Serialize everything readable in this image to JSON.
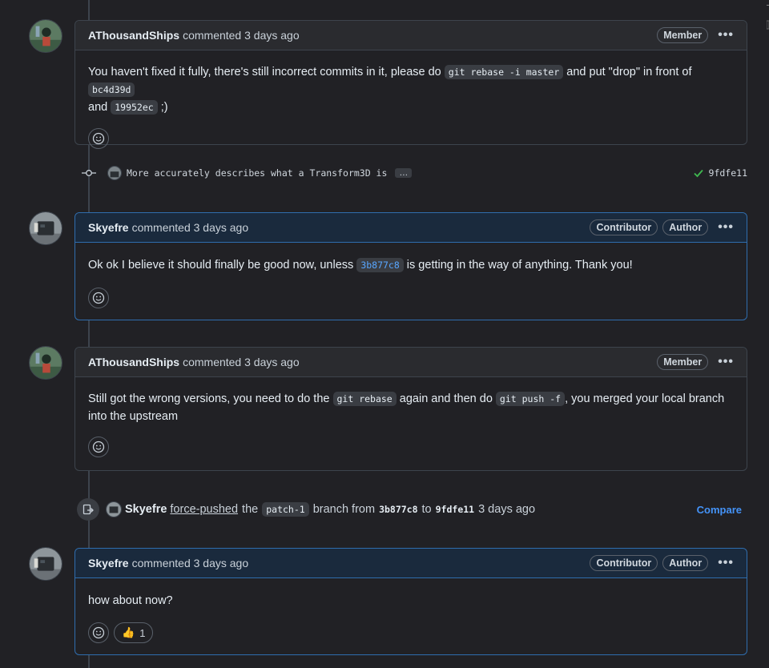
{
  "comments": [
    {
      "author": "AThousandShips",
      "action": "commented 3 days ago",
      "badges": [
        "Member"
      ],
      "body": {
        "t1": "You haven't fixed it fully, there's still incorrect commits in it, please do ",
        "c1": "git rebase -i master",
        "t2": " and put \"drop\" in front of ",
        "c2": "bc4d39d",
        "t3": " and ",
        "c3": "19952ec",
        "t4": " ;)"
      }
    },
    {
      "author": "Skyefre",
      "action": "commented 3 days ago",
      "badges": [
        "Contributor",
        "Author"
      ],
      "body": {
        "t1": "Ok ok I believe it should finally be good now, unless ",
        "c1": "3b877c8",
        "t2": " is getting in the way of anything. Thank you!"
      }
    },
    {
      "author": "AThousandShips",
      "action": "commented 3 days ago",
      "badges": [
        "Member"
      ],
      "body": {
        "t1": "Still got the wrong versions, you need to do the ",
        "c1": "git rebase",
        "t2": " again and then do ",
        "c2": "git push -f",
        "t3": ", you merged your local branch into the upstream"
      }
    },
    {
      "author": "Skyefre",
      "action": "commented 3 days ago",
      "badges": [
        "Contributor",
        "Author"
      ],
      "body": {
        "t1": "how about now?"
      },
      "reactions": {
        "thumbs_up": "1",
        "thumbs_glyph": "👍"
      }
    }
  ],
  "commit": {
    "message": "More accurately describes what a Transform3D is",
    "ellipsis": "…",
    "sha": "9fdfe11",
    "status": "success"
  },
  "force_push": {
    "author": "Skyefre",
    "action": "force-pushed",
    "the": "the",
    "branch": "patch-1",
    "branch_from": "branch from",
    "from_sha": "3b877c8",
    "to": "to",
    "to_sha": "9fdfe11",
    "time": "3 days ago",
    "compare": "Compare"
  },
  "more_glyph": "•••",
  "colors": {
    "background": "#212125",
    "border": "#3d444d",
    "own_border": "#2f6dae",
    "link": "#4493f8",
    "success": "#3fb950"
  },
  "icons": [
    "smiley-icon",
    "kebab-menu-icon",
    "git-commit-icon",
    "check-icon",
    "force-push-icon"
  ]
}
